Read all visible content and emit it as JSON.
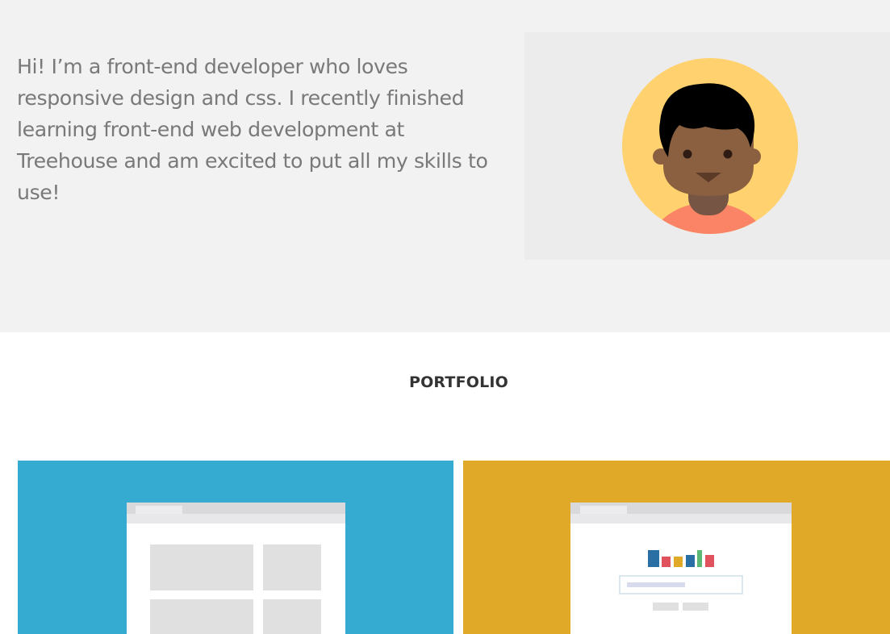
{
  "about": {
    "intro": "Hi! I’m a front-end developer who loves\nresponsive design and css. I recently finished\nlearning front-end web development at\nTreehouse and am excited to put all my skills to\nuse!",
    "avatar_icon": "avatar-illustration-icon"
  },
  "portfolio": {
    "title": "PORTFOLIO",
    "cards": [
      {
        "icon": "browser-grid-layout-icon",
        "color": "#35abd1"
      },
      {
        "icon": "browser-bar-chart-search-icon",
        "color": "#e0aa28"
      }
    ]
  },
  "colors": {
    "hero_background": "#f2f2f2",
    "avatar_background": "#ffd26f",
    "text_gray": "#797979"
  }
}
